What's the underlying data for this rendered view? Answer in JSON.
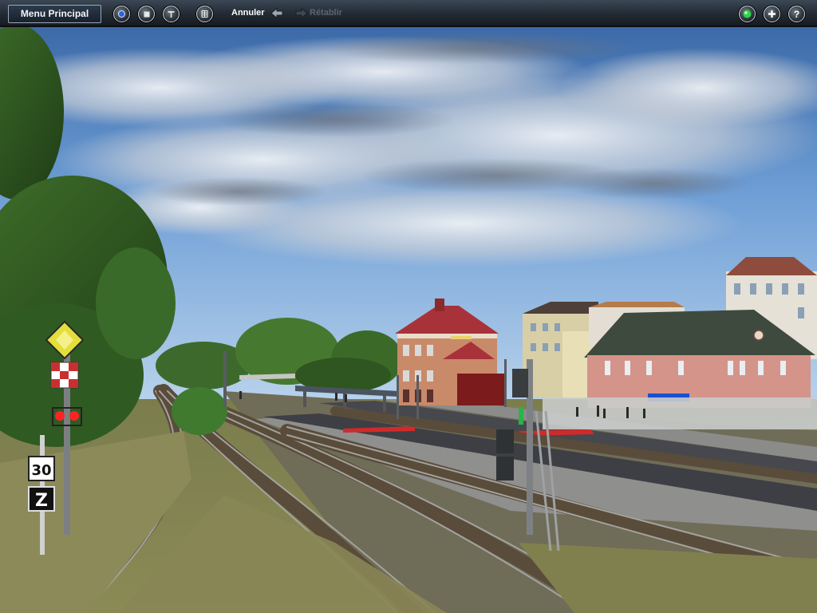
{
  "toolbar": {
    "main_menu_label": "Menu Principal",
    "undo_label": "Annuler",
    "redo_label": "Rétablir",
    "colors": {
      "bar": "#222a33",
      "text_active": "#ffffff",
      "text_disabled": "#5d6671",
      "status_green": "#2fd14a"
    },
    "icons": [
      "view-mode-icon",
      "stop-icon",
      "tools-icon",
      "grid-icon",
      "undo-arrow-icon",
      "redo-arrow-icon",
      "status-light-icon",
      "add-icon",
      "help-icon"
    ]
  },
  "scene": {
    "signs": {
      "speed_limit": "30",
      "zone_letter": "Z"
    }
  }
}
